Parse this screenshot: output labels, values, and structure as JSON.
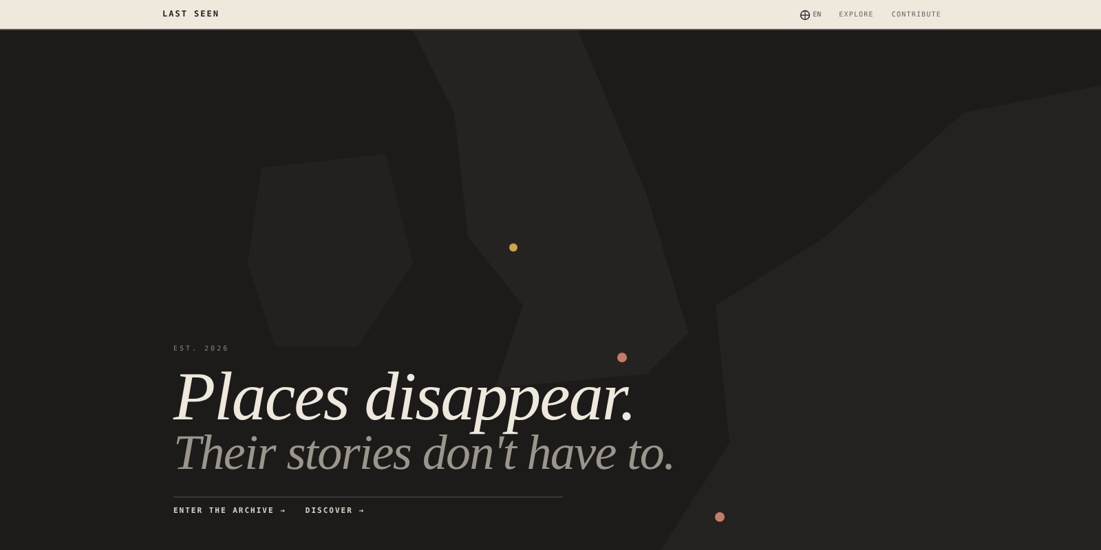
{
  "header": {
    "logo": "LAST SEEN",
    "language": "EN",
    "nav": [
      {
        "label": "EXPLORE"
      },
      {
        "label": "CONTRIBUTE"
      }
    ]
  },
  "hero": {
    "eyebrow": "EST. 2026",
    "headline": "Places disappear.",
    "subheadline": "Their stories don't have to.",
    "links": [
      {
        "label": "ENTER THE ARCHIVE",
        "arrow": "→"
      },
      {
        "label": "DISCOVER",
        "arrow": "→"
      }
    ]
  }
}
